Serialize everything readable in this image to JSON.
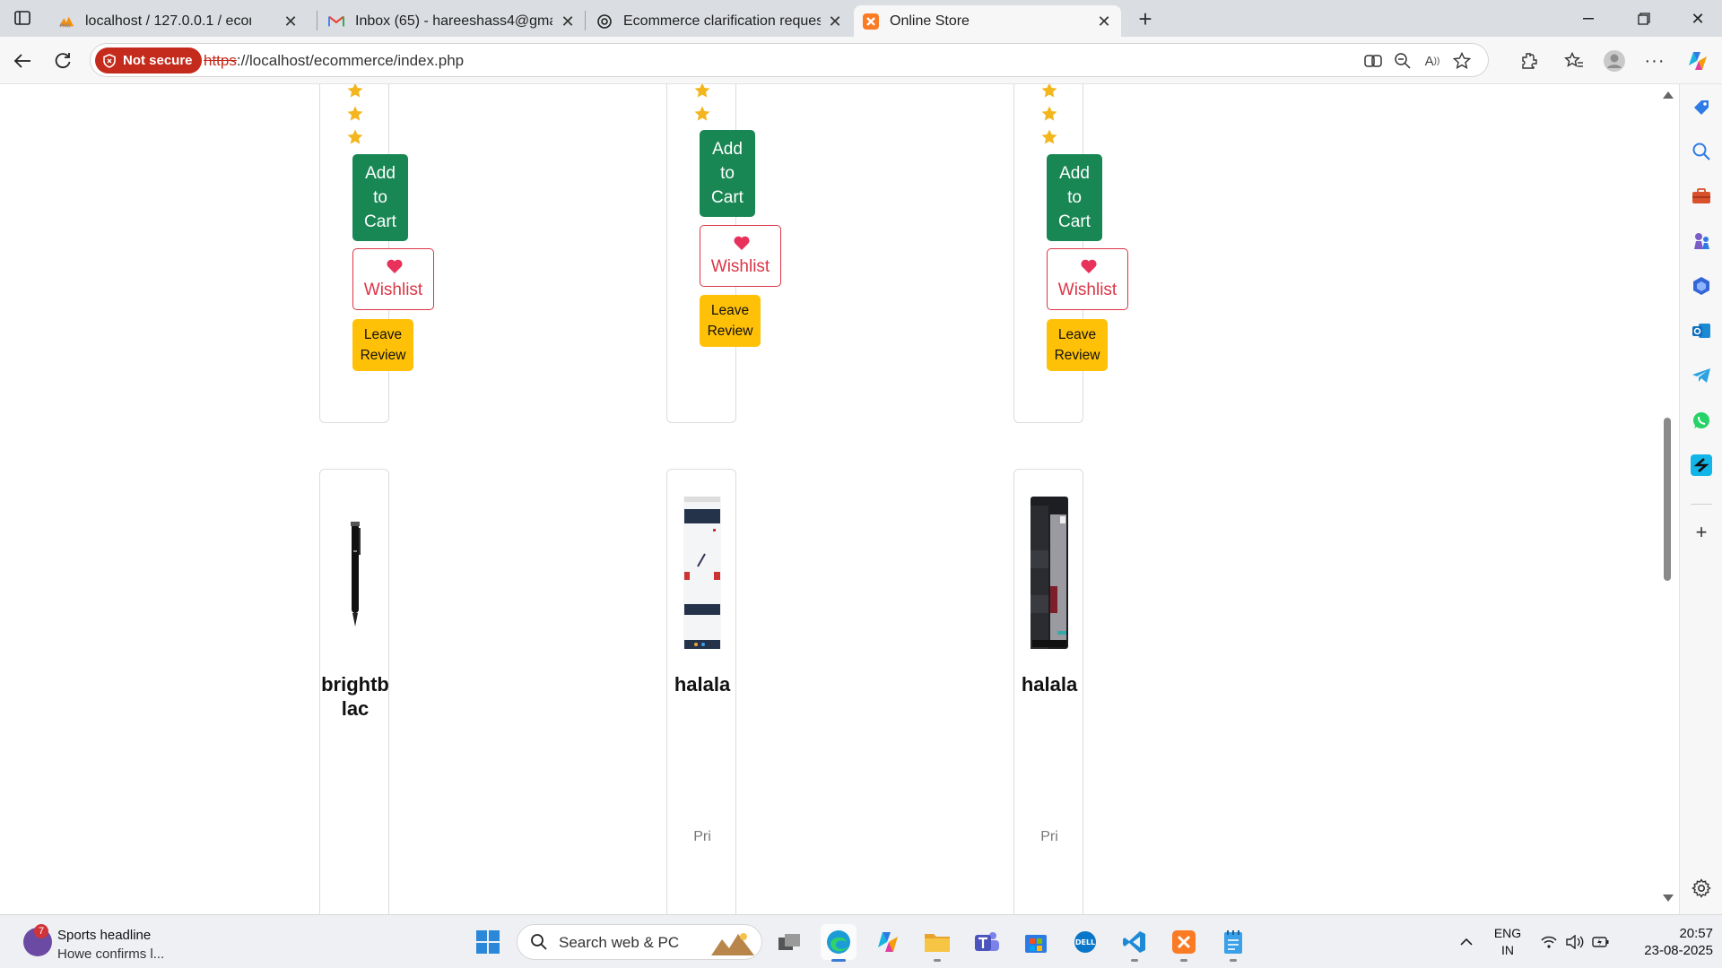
{
  "browser": {
    "tabs": [
      {
        "title": "localhost / 127.0.0.1 / ecommerce",
        "favicon": "phpmyadmin-icon"
      },
      {
        "title": "Inbox (65) - hareeshass4@gmail.com",
        "favicon": "gmail-icon"
      },
      {
        "title": "Ecommerce clarification request",
        "favicon": "chatgpt-icon"
      },
      {
        "title": "Online Store",
        "favicon": "xampp-icon",
        "active": true
      }
    ],
    "security_label": "Not secure",
    "url_scheme": "https",
    "url_rest": "://localhost/ecommerce/index.php"
  },
  "page": {
    "top_row": [
      {
        "cart_label": "Add to Cart",
        "wishlist_label": "Wishlist",
        "review_label": "Leave Review"
      },
      {
        "cart_label": "Add to Cart",
        "wishlist_label": "Wishlist",
        "review_label": "Leave Review"
      },
      {
        "cart_label": "Add to Cart",
        "wishlist_label": "Wishlist",
        "review_label": "Leave Review"
      }
    ],
    "bottom_row": [
      {
        "name_visible": "brightblac",
        "price_visible": ""
      },
      {
        "name_visible": "halala",
        "price_visible": "Pri"
      },
      {
        "name_visible": "halala",
        "price_visible": "Pri"
      }
    ]
  },
  "taskbar": {
    "news_badge": "7",
    "news_title": "Sports headline",
    "news_sub": "Howe confirms l...",
    "search_placeholder": "Search web & PC",
    "lang_line1": "ENG",
    "lang_line2": "IN",
    "time": "20:57",
    "date": "23-08-2025"
  },
  "colors": {
    "cart": "#198754",
    "wishlist": "#dc3545",
    "review": "#ffc107",
    "star": "#f3b61f",
    "not_secure": "#c42b1c"
  }
}
